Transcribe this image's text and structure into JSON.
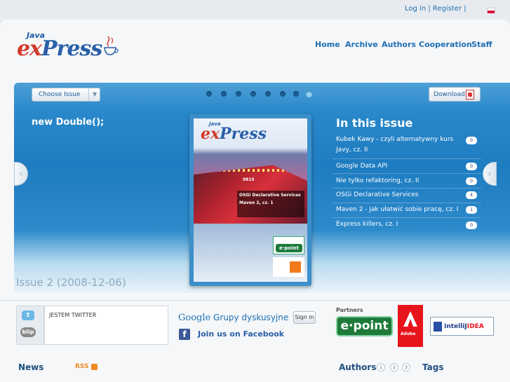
{
  "topbar": {
    "login": "Log in",
    "sep1": " | ",
    "register": "Register",
    "sep2": " |"
  },
  "logo": {
    "java": "Java",
    "ex": "ex",
    "press": "Press"
  },
  "nav": [
    "Home",
    "Archive",
    "Authors",
    "Cooperation",
    "Staff"
  ],
  "slider": {
    "choose_issue": "Choose Issue",
    "download": "Download",
    "headline": "new Double();",
    "dots_total": 8,
    "dots_active_index": 7,
    "issue_label": "Issue 2 (2008-12-06)"
  },
  "cover": {
    "tag_line1": "OSGi Declarative Services",
    "tag_line2": "Maven 2, cz. 1",
    "train_number": "9815",
    "epoint": "e·point"
  },
  "in_this_issue": {
    "title": "In this issue",
    "items": [
      {
        "title": "Kubek Kawy - czyli alternatywny kurs",
        "title2": "Javy, cz. II",
        "comments": "0"
      },
      {
        "title": "Google Data API",
        "comments": "0"
      },
      {
        "title": "Nie tylko refaktoring, cz. II",
        "comments": "0"
      },
      {
        "title": "OSGi Declarative Services",
        "comments": "4"
      },
      {
        "title": "Maven 2 - jak ułatwić sobie pracę, cz. I",
        "comments": "1"
      },
      {
        "title": "Express killers, cz. I",
        "comments": "0"
      }
    ]
  },
  "social": {
    "twitter_icon_label": "t",
    "blip_icon_label": "blip",
    "tweet_text": "JESTEM TWITTER",
    "google_brand": "Google",
    "google_groups": " Grupy dyskusyjne",
    "sign_in": "Sign in",
    "facebook": "Join us on Facebook"
  },
  "partners": {
    "label": "Partners",
    "epoint": "e·point",
    "adobe": "Adobe",
    "intellij_a": "IntelliJ",
    "intellij_b": "IDEA"
  },
  "bottom": {
    "news": "News",
    "rss": "RSS",
    "authors": "Authors",
    "pages": [
      "1",
      "2",
      "3"
    ],
    "tags": "Tags"
  },
  "colors": {
    "accent": "#1f6fb2",
    "stage": "#2a87c8",
    "brand_red": "#d23a2a"
  },
  "icons": [
    "flag-icon",
    "coffee-cup-icon",
    "pdf-icon",
    "twitter-icon",
    "blip-icon",
    "facebook-icon",
    "rss-icon",
    "chevron-left-icon",
    "chevron-right-icon",
    "chevron-down-icon"
  ]
}
